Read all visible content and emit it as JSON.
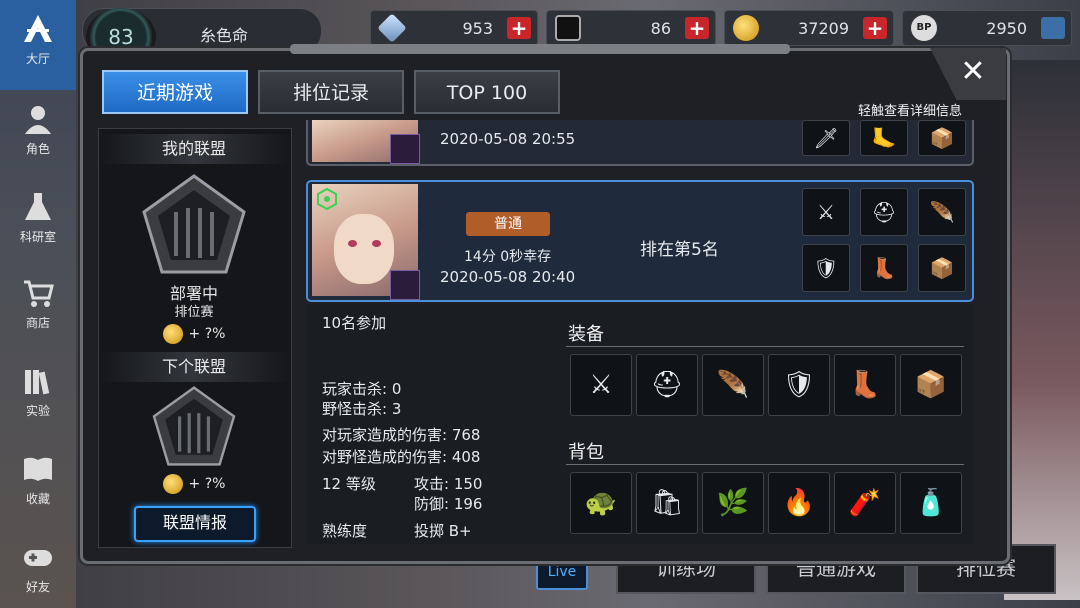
{
  "nav": {
    "items": [
      {
        "label": "大厅",
        "icon": "lobby-icon"
      },
      {
        "label": "角色",
        "icon": "character-icon"
      },
      {
        "label": "科研室",
        "icon": "flask-icon"
      },
      {
        "label": "商店",
        "icon": "cart-icon"
      },
      {
        "label": "实验",
        "icon": "books-icon"
      },
      {
        "label": "收藏",
        "icon": "book-icon"
      },
      {
        "label": "好友",
        "icon": "gamepad-icon"
      }
    ]
  },
  "profile": {
    "level": "83",
    "name": "糸色命"
  },
  "resources": [
    {
      "icon": "crystal-icon",
      "value": "953"
    },
    {
      "icon": "card-icon",
      "value": "86"
    },
    {
      "icon": "coin-icon",
      "value": "37209"
    },
    {
      "icon": "bp-icon",
      "value": "2950"
    }
  ],
  "modal": {
    "tabs": [
      {
        "label": "近期游戏",
        "active": true
      },
      {
        "label": "排位记录",
        "active": false
      },
      {
        "label": "TOP 100",
        "active": false
      }
    ],
    "hint": "轻触查看详细信息",
    "close_label": "✕"
  },
  "alliance": {
    "my_title": "我的联盟",
    "status": "部署中",
    "mode": "排位赛",
    "my_bonus": "+ ?%",
    "next_title": "下个联盟",
    "next_bonus": "+ ?%",
    "info_button": "联盟情报"
  },
  "records": [
    {
      "datetime": "2020-05-08 20:55"
    },
    {
      "mode_tag": "普通",
      "survival": "14分 0秒幸存",
      "datetime": "2020-05-08 20:40",
      "rank_text": "排在第5名"
    }
  ],
  "details": {
    "participants": "10名参加",
    "player_kills": "玩家击杀: 0",
    "monster_kills": "野怪击杀: 3",
    "damage_players": "对玩家造成的伤害: 768",
    "damage_monsters": "对野怪造成的伤害: 408",
    "level": "12 等级",
    "attack": "攻击: 150",
    "defense": "防御: 196",
    "proficiency_label": "熟练度",
    "proficiency_value": "投掷 B+",
    "equipment_title": "装备",
    "backpack_title": "背包"
  },
  "bottom_buttons": [
    "训练场",
    "普通游戏",
    "排位赛"
  ],
  "live_label": "Live",
  "colors": {
    "accent": "#2f86e0",
    "plus_red": "#c8262a",
    "mode_tag": "#b15d2a"
  }
}
